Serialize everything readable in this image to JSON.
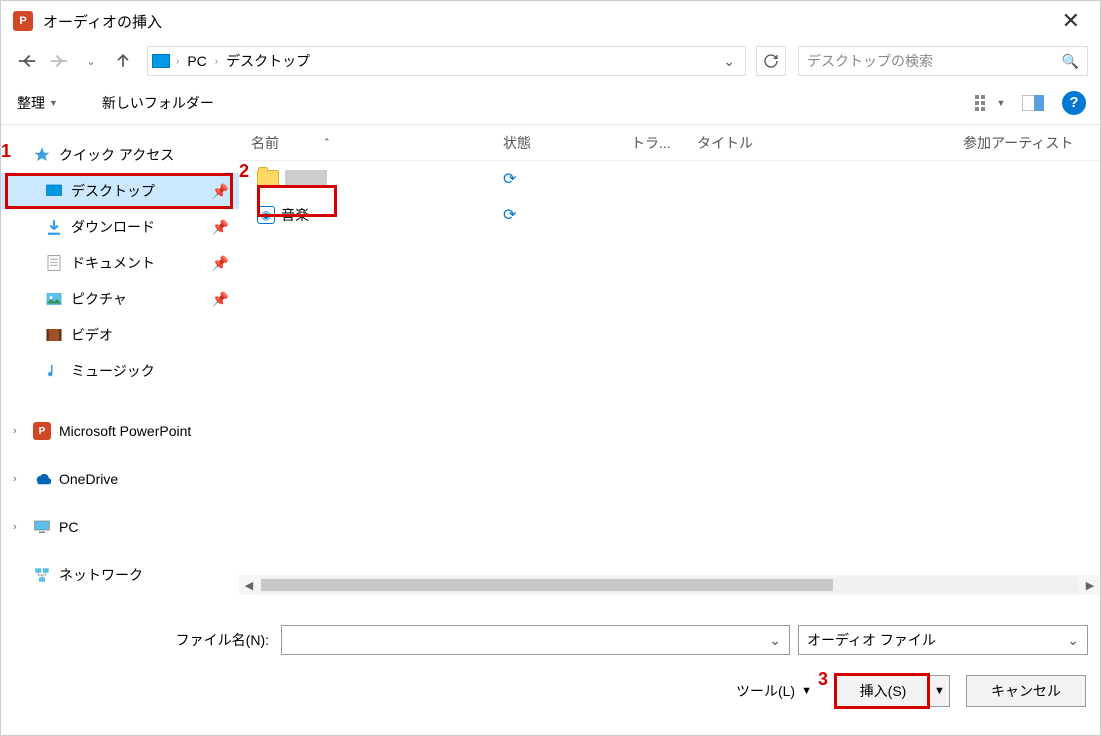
{
  "window": {
    "title": "オーディオの挿入"
  },
  "nav": {
    "crumbs": [
      "PC",
      "デスクトップ"
    ],
    "search_placeholder": "デスクトップの検索"
  },
  "toolbar": {
    "organize": "整理",
    "new_folder": "新しいフォルダー"
  },
  "columns": {
    "name": "名前",
    "status": "状態",
    "track": "トラ...",
    "title": "タイトル",
    "artist": "参加アーティスト"
  },
  "sidebar": {
    "quick_access": "クイック アクセス",
    "items": [
      {
        "label": "デスクトップ",
        "pinned": true,
        "selected": true
      },
      {
        "label": "ダウンロード",
        "pinned": true
      },
      {
        "label": "ドキュメント",
        "pinned": true
      },
      {
        "label": "ピクチャ",
        "pinned": true
      },
      {
        "label": "ビデオ"
      },
      {
        "label": "ミュージック"
      }
    ],
    "powerpoint": "Microsoft PowerPoint",
    "onedrive": "OneDrive",
    "pc": "PC",
    "network": "ネットワーク"
  },
  "files": [
    {
      "name": "",
      "type": "folder",
      "status": "sync"
    },
    {
      "name": "音楽",
      "type": "audio",
      "status": "sync"
    }
  ],
  "bottom": {
    "filename_label": "ファイル名(N):",
    "filetype": "オーディオ ファイル",
    "tools": "ツール(L)",
    "insert": "挿入(S)",
    "cancel": "キャンセル"
  },
  "annotations": {
    "n1": "1",
    "n2": "2",
    "n3": "3"
  }
}
